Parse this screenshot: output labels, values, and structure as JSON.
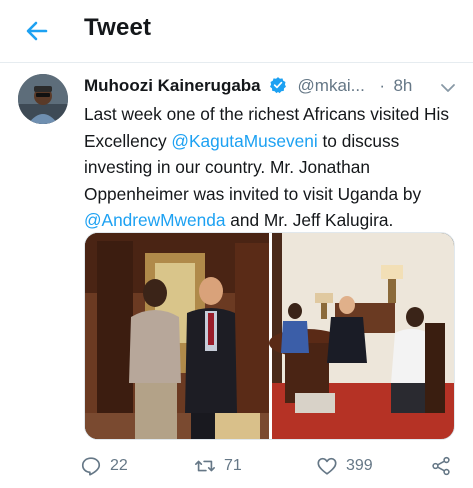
{
  "header": {
    "title": "Tweet",
    "back_icon": "arrow-left-icon",
    "accent": "#1da1f2"
  },
  "tweet": {
    "author_name": "Muhoozi Kainerugaba",
    "handle": "@mkai...",
    "separator": "·",
    "time": "8h",
    "verified": true,
    "text_parts": {
      "p1": "Last week one of the richest Africans visited His Excellency ",
      "m1": "@KagutaMuseveni",
      "p2": " to discuss investing in our country. Mr. Jonathan Oppenheimer was invited to visit Uganda by ",
      "m2": "@AndrewMwenda",
      "p3": " and Mr. Jeff Kalugira."
    }
  },
  "actions": {
    "reply_count": "22",
    "retweet_count": "71",
    "like_count": "399"
  }
}
